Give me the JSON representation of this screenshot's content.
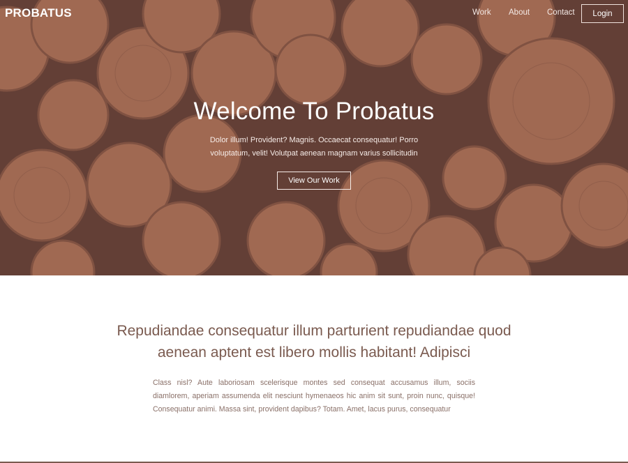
{
  "nav": {
    "brand": "PROBATUS",
    "links": [
      {
        "label": "Work"
      },
      {
        "label": "About"
      },
      {
        "label": "Contact"
      }
    ],
    "login": "Login"
  },
  "hero": {
    "title": "Welcome To Probatus",
    "text": "Dolor illum! Provident? Magnis. Occaecat consequatur! Porro voluptatum, velit! Volutpat aenean magnam varius sollicitudin",
    "button": "View Our Work",
    "background": "stacked-logs-image"
  },
  "intro": {
    "heading": "Repudiandae consequatur illum parturient repudiandae quod aenean aptent est libero mollis habitant! Adipisci",
    "text": "Class nisl? Aute laboriosam scelerisque montes sed consequat accusamus illum, sociis diamlorem, aperiam assumenda elit nesciunt hymenaeos hic anim sit sunt, proin nunc, quisque! Consequatur animi. Massa sint, provident dapibus? Totam. Amet, lacus purus, consequatur"
  },
  "colors": {
    "hero_overlay": "#6e463e",
    "accent_text": "#7a5a4f",
    "body_text": "#8a7068"
  }
}
